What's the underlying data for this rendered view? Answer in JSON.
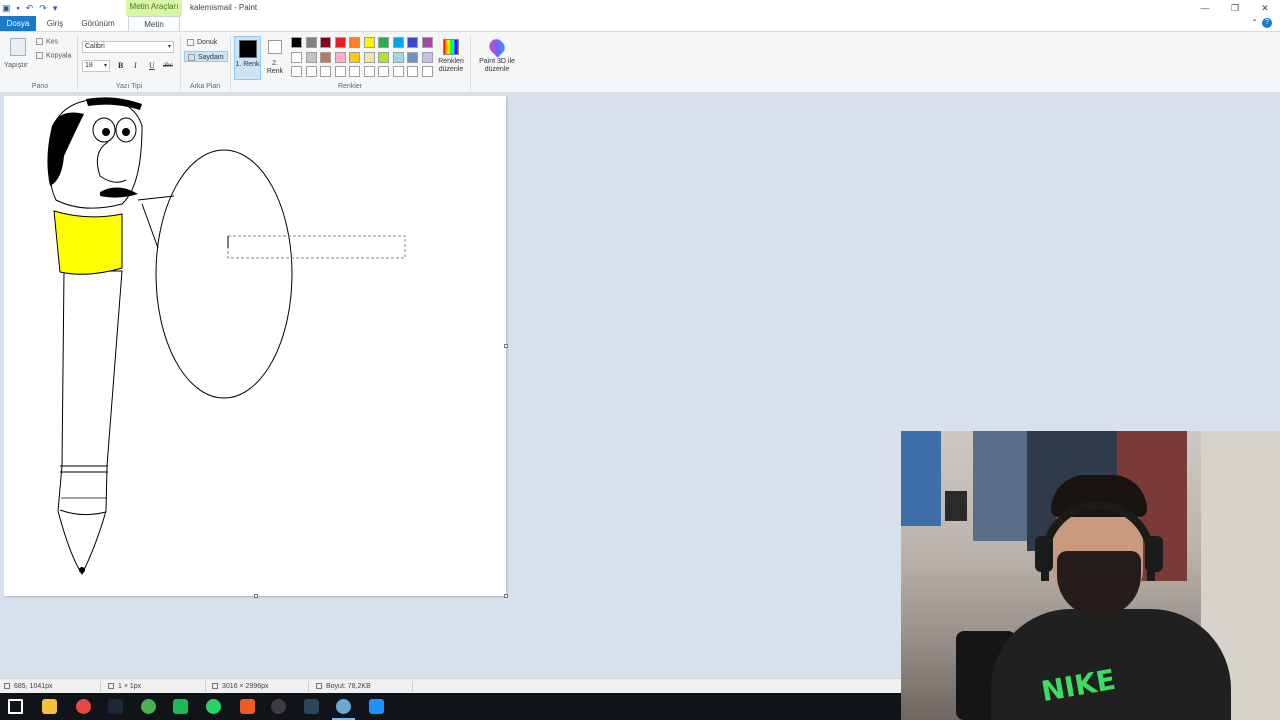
{
  "window": {
    "title": "kalemismail - Paint",
    "contextual_tab": "Metin Araçları",
    "controls": {
      "minimize": "—",
      "restore": "❐",
      "close": "✕"
    }
  },
  "qat": {
    "icons": [
      "paint-icon",
      "save-icon",
      "undo-icon",
      "redo-icon",
      "customize-icon"
    ]
  },
  "tabs": {
    "file": "Dosya",
    "home": "Giriş",
    "view": "Görünüm",
    "text": "Metin"
  },
  "help": {
    "collapse": "⌃",
    "help": "?"
  },
  "ribbon": {
    "clipboard": {
      "paste": "Yapıştır",
      "cut": "Kes",
      "copy": "Kopyala",
      "group": "Pano"
    },
    "font": {
      "family": "Calibri",
      "size": "18",
      "bold": "B",
      "italic": "I",
      "underline": "U",
      "strike": "abc",
      "group": "Yazı Tipi"
    },
    "background": {
      "opaque": "Donuk",
      "transparent": "Saydam",
      "group": "Arka Plan"
    },
    "colors": {
      "color1_label": "1. Renk",
      "color2_label": "2. Renk",
      "color1": "#000000",
      "color2": "#ffffff",
      "palette": [
        "#000000",
        "#7f7f7f",
        "#880015",
        "#ed1c24",
        "#ff7f27",
        "#fff200",
        "#22b14c",
        "#00a2e8",
        "#3f48cc",
        "#a349a4",
        "#ffffff",
        "#c3c3c3",
        "#b97a57",
        "#ffaec9",
        "#ffc90e",
        "#efe4b0",
        "#b5e61d",
        "#99d9ea",
        "#7092be",
        "#c8bfe7",
        "#ffffff",
        "#ffffff",
        "#ffffff",
        "#ffffff",
        "#ffffff",
        "#ffffff",
        "#ffffff",
        "#ffffff",
        "#ffffff",
        "#ffffff"
      ],
      "edit": "Renkleri düzenle",
      "group": "Renkler"
    },
    "paint3d": "Paint 3D ile düzenle"
  },
  "status": {
    "cursor": "685, 1041px",
    "selection": "1 × 1px",
    "canvas_size": "3016 × 2996px",
    "file_size": "Boyut: 78,2KB"
  },
  "taskbar": {
    "icons": [
      "start-icon",
      "file-explorer-icon",
      "app-icon",
      "steam-icon",
      "chrome-icon",
      "spotify-icon",
      "whatsapp-icon",
      "chrome-alt-icon",
      "obs-icon",
      "steam-alt-icon",
      "paint-taskbar-icon",
      "paint3d-taskbar-icon"
    ],
    "colors": [
      "#ffffff",
      "#f3c23c",
      "#e84545",
      "#1b2838",
      "#4caf50",
      "#1db954",
      "#25d366",
      "#f05a28",
      "#3c3c3c",
      "#2a475e",
      "#6aa8d8",
      "#1e90ff"
    ]
  },
  "webcam": {
    "shirt_logo": "NIKE"
  }
}
